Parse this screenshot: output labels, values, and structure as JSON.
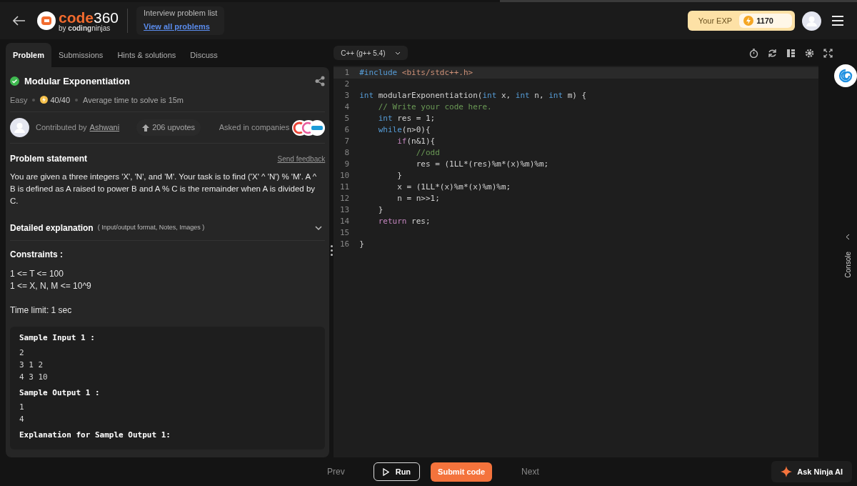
{
  "header": {
    "logo": {
      "word": "code",
      "number": "360",
      "tagline": "by **coding**ninjas"
    },
    "breadcrumb": {
      "title": "Interview problem list",
      "link": "View all problems"
    },
    "exp": {
      "label": "Your EXP",
      "value": "1170"
    }
  },
  "tabs": [
    {
      "label": "Problem",
      "selected": true
    },
    {
      "label": "Submissions",
      "selected": false
    },
    {
      "label": "Hints & solutions",
      "selected": false
    },
    {
      "label": "Discuss",
      "selected": false
    }
  ],
  "problem": {
    "title": "Modular Exponentiation",
    "solved": true,
    "difficulty": "Easy",
    "score": "40/40",
    "avg_time": "Average time to solve is 15m",
    "contributed_label": "Contributed by",
    "contributor": "Ashwani",
    "upvotes": "206 upvotes",
    "companies_label": "Asked in companies",
    "statement_heading": "Problem statement",
    "feedback": "Send feedback",
    "statement": "You are given a three integers 'X', 'N', and 'M'. Your task is to find ('X' ^ 'N') % 'M'. A ^ B is defined as A raised to power B and A % C is the remainder when A is divided by C.",
    "explanation": {
      "title": "Detailed explanation",
      "subtitle": "( Input/output format, Notes, Images )",
      "expanded": false
    },
    "constraints_heading": "Constraints :",
    "constraints": [
      "1 <= T <= 100",
      "1 <= X, N, M <= 10^9"
    ],
    "time_limit": "Time limit: 1 sec",
    "samples": [
      {
        "kind": "heading",
        "text": "Sample Input 1 :"
      },
      {
        "kind": "value",
        "text": "2"
      },
      {
        "kind": "value",
        "text": "3 1 2"
      },
      {
        "kind": "value",
        "text": "4 3 10"
      },
      {
        "kind": "heading",
        "text": "Sample Output 1 :"
      },
      {
        "kind": "value",
        "text": "1"
      },
      {
        "kind": "value",
        "text": "4"
      },
      {
        "kind": "heading",
        "text": "Explanation for Sample Output 1:"
      }
    ]
  },
  "editor": {
    "language": "C++ (g++ 5.4)",
    "console_label": "Console",
    "lines": [
      {
        "number": "1",
        "active": true,
        "tokens": [
          {
            "kind": "kw",
            "text": "#include"
          },
          {
            "kind": "str",
            "text": " <bits/stdc++.h>"
          }
        ]
      },
      {
        "number": "2",
        "active": false
      },
      {
        "number": "3",
        "active": false,
        "tokens": [
          {
            "kind": "kw",
            "text": "int"
          },
          {
            "kind": "tx",
            "text": " modularExponentiation("
          },
          {
            "kind": "kw",
            "text": "int"
          },
          {
            "kind": "tx",
            "text": " x, "
          },
          {
            "kind": "kw",
            "text": "int"
          },
          {
            "kind": "tx",
            "text": " n, "
          },
          {
            "kind": "kw",
            "text": "int"
          },
          {
            "kind": "tx",
            "text": " m) {"
          }
        ]
      },
      {
        "number": "4",
        "active": false,
        "tokens": [
          {
            "kind": "cm",
            "text": "    // Write your code here."
          }
        ]
      },
      {
        "number": "5",
        "active": false,
        "tokens": [
          {
            "kind": "kw",
            "text": "    int"
          },
          {
            "kind": "tx",
            "text": " res = 1;"
          }
        ]
      },
      {
        "number": "6",
        "active": false,
        "tokens": [
          {
            "kind": "kw",
            "text": "    while"
          },
          {
            "kind": "tx",
            "text": "(n>0){"
          }
        ]
      },
      {
        "number": "7",
        "active": false,
        "tokens": [
          {
            "kind": "ctl",
            "text": "        if"
          },
          {
            "kind": "tx",
            "text": "(n&1){"
          }
        ]
      },
      {
        "number": "8",
        "active": false,
        "tokens": [
          {
            "kind": "cm",
            "text": "            //odd"
          }
        ]
      },
      {
        "number": "9",
        "active": false,
        "tokens": [
          {
            "kind": "tx",
            "text": "            res = (1LL*(res)%m*(x)%m)%m;"
          }
        ]
      },
      {
        "number": "10",
        "active": false,
        "tokens": [
          {
            "kind": "tx",
            "text": "        }"
          }
        ]
      },
      {
        "number": "11",
        "active": false,
        "tokens": [
          {
            "kind": "tx",
            "text": "        x = (1LL*(x)%m*(x)%m)%m;"
          }
        ]
      },
      {
        "number": "12",
        "active": false,
        "tokens": [
          {
            "kind": "tx",
            "text": "        n = n>>1;"
          }
        ]
      },
      {
        "number": "13",
        "active": false,
        "tokens": [
          {
            "kind": "tx",
            "text": "    }"
          }
        ]
      },
      {
        "number": "14",
        "active": false,
        "tokens": [
          {
            "kind": "ctl",
            "text": "    return"
          },
          {
            "kind": "tx",
            "text": " res;"
          }
        ]
      },
      {
        "number": "15",
        "active": false
      },
      {
        "number": "16",
        "active": false,
        "tokens": [
          {
            "kind": "tx",
            "text": "}"
          }
        ]
      }
    ]
  },
  "footer": {
    "prev": "Prev",
    "run": "Run",
    "submit": "Submit code",
    "next": "Next",
    "ai": "Ask Ninja AI"
  }
}
